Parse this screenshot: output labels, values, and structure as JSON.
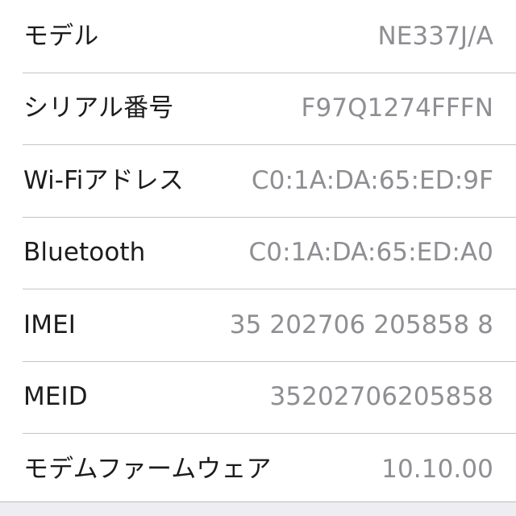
{
  "screen": {
    "name": "device-information-list",
    "background_color": "#ffffff",
    "label_color": "#1c1c1e",
    "value_color": "#8e8e93",
    "separator_color": "#bdbdc2",
    "footer_color": "#eeeef2"
  },
  "rows": [
    {
      "label": "モデル",
      "value": "NE337J/A"
    },
    {
      "label": "シリアル番号",
      "value": "F97Q1274FFFN"
    },
    {
      "label": "Wi-Fiアドレス",
      "value": "C0:1A:DA:65:ED:9F"
    },
    {
      "label": "Bluetooth",
      "value": "C0:1A:DA:65:ED:A0"
    },
    {
      "label": "IMEI",
      "value": "35 202706 205858 8"
    },
    {
      "label": "MEID",
      "value": "35202706205858"
    },
    {
      "label": "モデムファームウェア",
      "value": "10.10.00"
    }
  ]
}
